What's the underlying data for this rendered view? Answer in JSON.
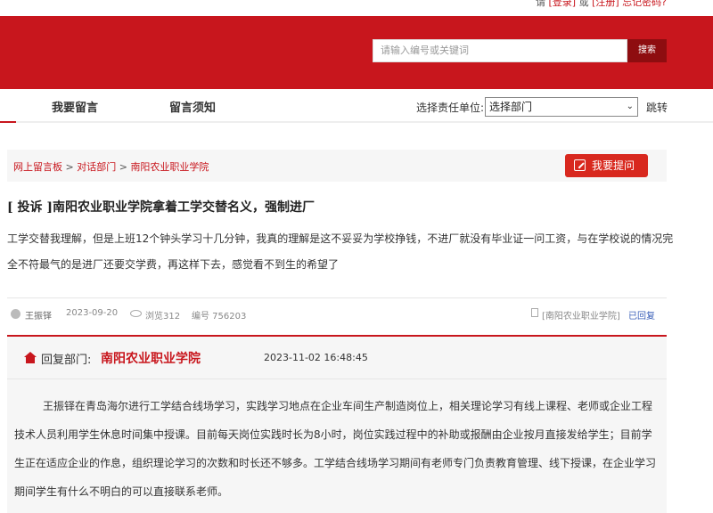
{
  "topbar": {
    "prefix": "请",
    "login": "[登录]",
    "or": "或",
    "register": "[注册]",
    "forgot": "忘记密码?"
  },
  "search": {
    "placeholder": "请输入编号或关键词",
    "button": "搜索"
  },
  "nav": {
    "item1": "我要留言",
    "item2": "留言须知",
    "dept_label": "选择责任单位:",
    "dept_select": "选择部门",
    "jump": "跳转"
  },
  "breadcrumb": {
    "c1": "网上留言板",
    "c2": "对话部门",
    "c3": "南阳农业职业学院",
    "sep": ">"
  },
  "ask_button": "我要提问",
  "post": {
    "tag": "[ 投诉 ]",
    "title": "南阳农业职业学院拿着工学交替名义，强制进厂",
    "body": "工学交替我理解，但是上班12个钟头学习十几分钟，我真的理解是这不妥妥为学校挣钱，不进厂就没有毕业证一问工资，与在学校说的情况完全不符最气的是进厂还要交学费，再这样下去，感觉看不到生的希望了",
    "author": "王振铎",
    "date": "2023-09-20",
    "views": "浏览312",
    "number": "编号 756203",
    "dept_tag": "[南阳农业职业学院]",
    "status": "已回复"
  },
  "reply": {
    "label": "回复部门:",
    "dept": "南阳农业职业学院",
    "time": "2023-11-02 16:48:45",
    "body": "王振铎在青岛海尔进行工学结合线场学习，实践学习地点在企业车间生产制造岗位上，相关理论学习有线上课程、老师或企业工程技术人员利用学生休息时间集中授课。目前每天岗位实践时长为8小时，岗位实践过程中的补助或报酬由企业按月直接发给学生；目前学生正在适应企业的作息，组织理论学习的次数和时长还不够多。工学结合线场学习期间有老师专门负责教育管理、线下授课，在企业学习期间学生有什么不明白的可以直接联系老师。"
  }
}
